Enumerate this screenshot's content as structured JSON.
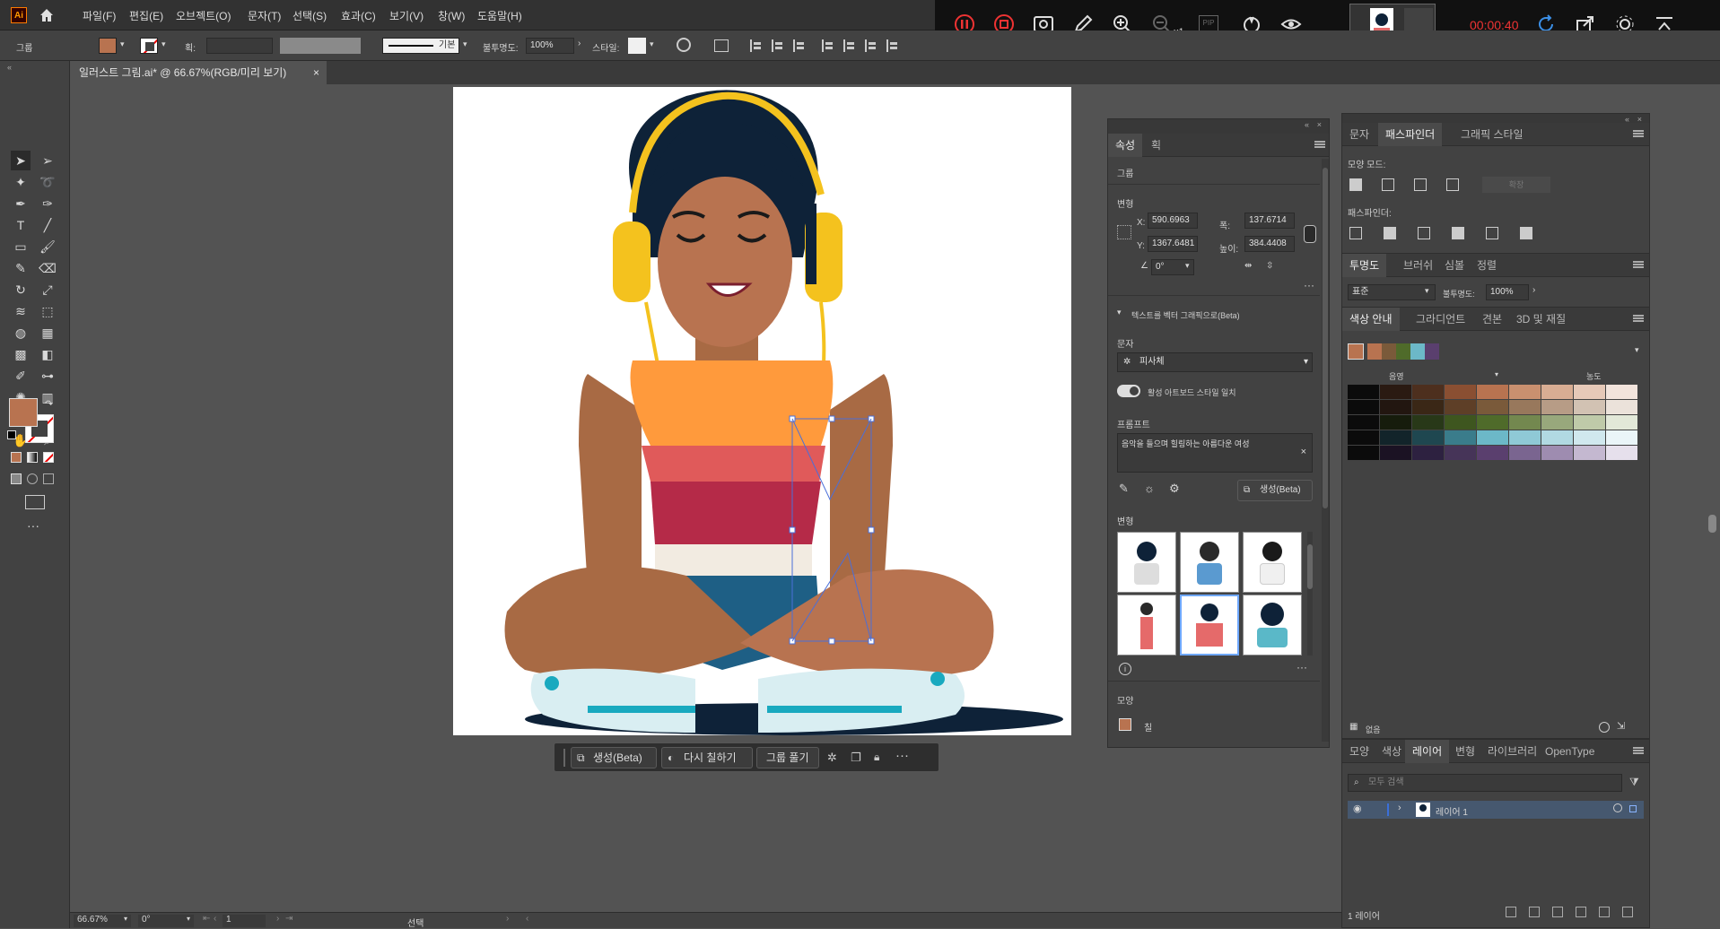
{
  "app": {
    "logo": "Ai",
    "home_icon": "home-icon"
  },
  "menu": [
    "파일(F)",
    "편집(E)",
    "오브젝트(O)",
    "문자(T)",
    "선택(S)",
    "효과(C)",
    "보기(V)",
    "창(W)",
    "도움말(H)"
  ],
  "control": {
    "selection_label": "그룹",
    "stroke_label": "획:",
    "stroke_style": "기본",
    "opacity_label": "불투명도:",
    "opacity_value": "100%",
    "style_label": "스타일:"
  },
  "recorder": {
    "time": "00:00:40",
    "zoom": "x1",
    "pip": "PIP"
  },
  "document_tab": {
    "title": "일러스트 그림.ai* @ 66.67%(RGB/미리 보기)",
    "close": "×"
  },
  "context_bar": {
    "generate": "생성(Beta)",
    "recolor": "다시 칠하기",
    "ungroup": "그룹 풀기"
  },
  "properties_panel": {
    "tabs": [
      "속성",
      "획"
    ],
    "selection_type": "그룹",
    "transform_label": "변형",
    "x_label": "X:",
    "x_value": "590.6963",
    "y_label": "Y:",
    "y_value": "1367.6481",
    "w_label": "폭:",
    "w_value": "137.6714",
    "h_label": "높이:",
    "h_value": "384.4408",
    "angle_value": "0°",
    "text_to_vector_label": "텍스트를 벡터 그래픽으로(Beta)",
    "type_label": "문자",
    "type_value": "피사체",
    "match_style_label": "활성 아트보드 스타일 일치",
    "prompt_label": "프롬프트",
    "prompt_text": "음악을 들으며 힐링하는 아름다운  여성",
    "generate_button": "생성(Beta)",
    "variations_label": "변형",
    "appearance_label": "모양",
    "fill_label": "칠"
  },
  "pathfinder_panel": {
    "tabs": [
      "문자",
      "패스파인더",
      "그래픽 스타일"
    ],
    "shape_modes_label": "모양 모드:",
    "expand_button": "확장",
    "pathfinders_label": "패스파인더:"
  },
  "transparency_panel": {
    "tabs": [
      "투명도",
      "브러쉬",
      "심볼",
      "정렬"
    ],
    "blend_mode": "표준",
    "opacity_label": "불투명도:",
    "opacity_value": "100%"
  },
  "color_guide_panel": {
    "tabs": [
      "색상 안내",
      "그라디언트",
      "견본",
      "3D 및 재질"
    ],
    "shade_label": "음영",
    "tint_label": "농도",
    "footer_label": "없음",
    "harmony_colors": [
      "#b87350",
      "#7a5a3a",
      "#4f6b2a",
      "#6cb8c8",
      "#5a3f6e"
    ],
    "grid_rows": [
      [
        "#0b0b0b",
        "#2a1a12",
        "#4d2f1e",
        "#8a4f32",
        "#b87350",
        "#c9906f",
        "#d8ad93",
        "#e6c9b8",
        "#f2e4dc"
      ],
      [
        "#0b0b0b",
        "#221610",
        "#3a2716",
        "#5e3f27",
        "#7a5a3a",
        "#98785c",
        "#b79c86",
        "#d2c2b3",
        "#ebe2da"
      ],
      [
        "#0b0b0b",
        "#161c0c",
        "#283818",
        "#3e561f",
        "#4f6b2a",
        "#73884f",
        "#98a87c",
        "#bfcaa9",
        "#e2e8d8"
      ],
      [
        "#0b0b0b",
        "#12242a",
        "#1f4750",
        "#3a7c8b",
        "#6cb8c8",
        "#8fc9d6",
        "#b1d9e2",
        "#d0e8ee",
        "#eaf5f8"
      ],
      [
        "#0b0b0b",
        "#1b1223",
        "#2d2140",
        "#463458",
        "#5a3f6e",
        "#7a6590",
        "#9e8cb0",
        "#c4b8d0",
        "#e6e0ec"
      ]
    ]
  },
  "layers_panel": {
    "tabs": [
      "모양",
      "색상",
      "레이어",
      "변형",
      "라이브러리",
      "OpenType"
    ],
    "search_placeholder": "모두 검색",
    "layer_name": "레이어 1",
    "footer": "1 레이어"
  },
  "status": {
    "zoom": "66.67%",
    "angle": "0°",
    "page": "1",
    "tool": "선택"
  },
  "colors": {
    "fill": "#b87350",
    "accent": "#4a90d9"
  }
}
